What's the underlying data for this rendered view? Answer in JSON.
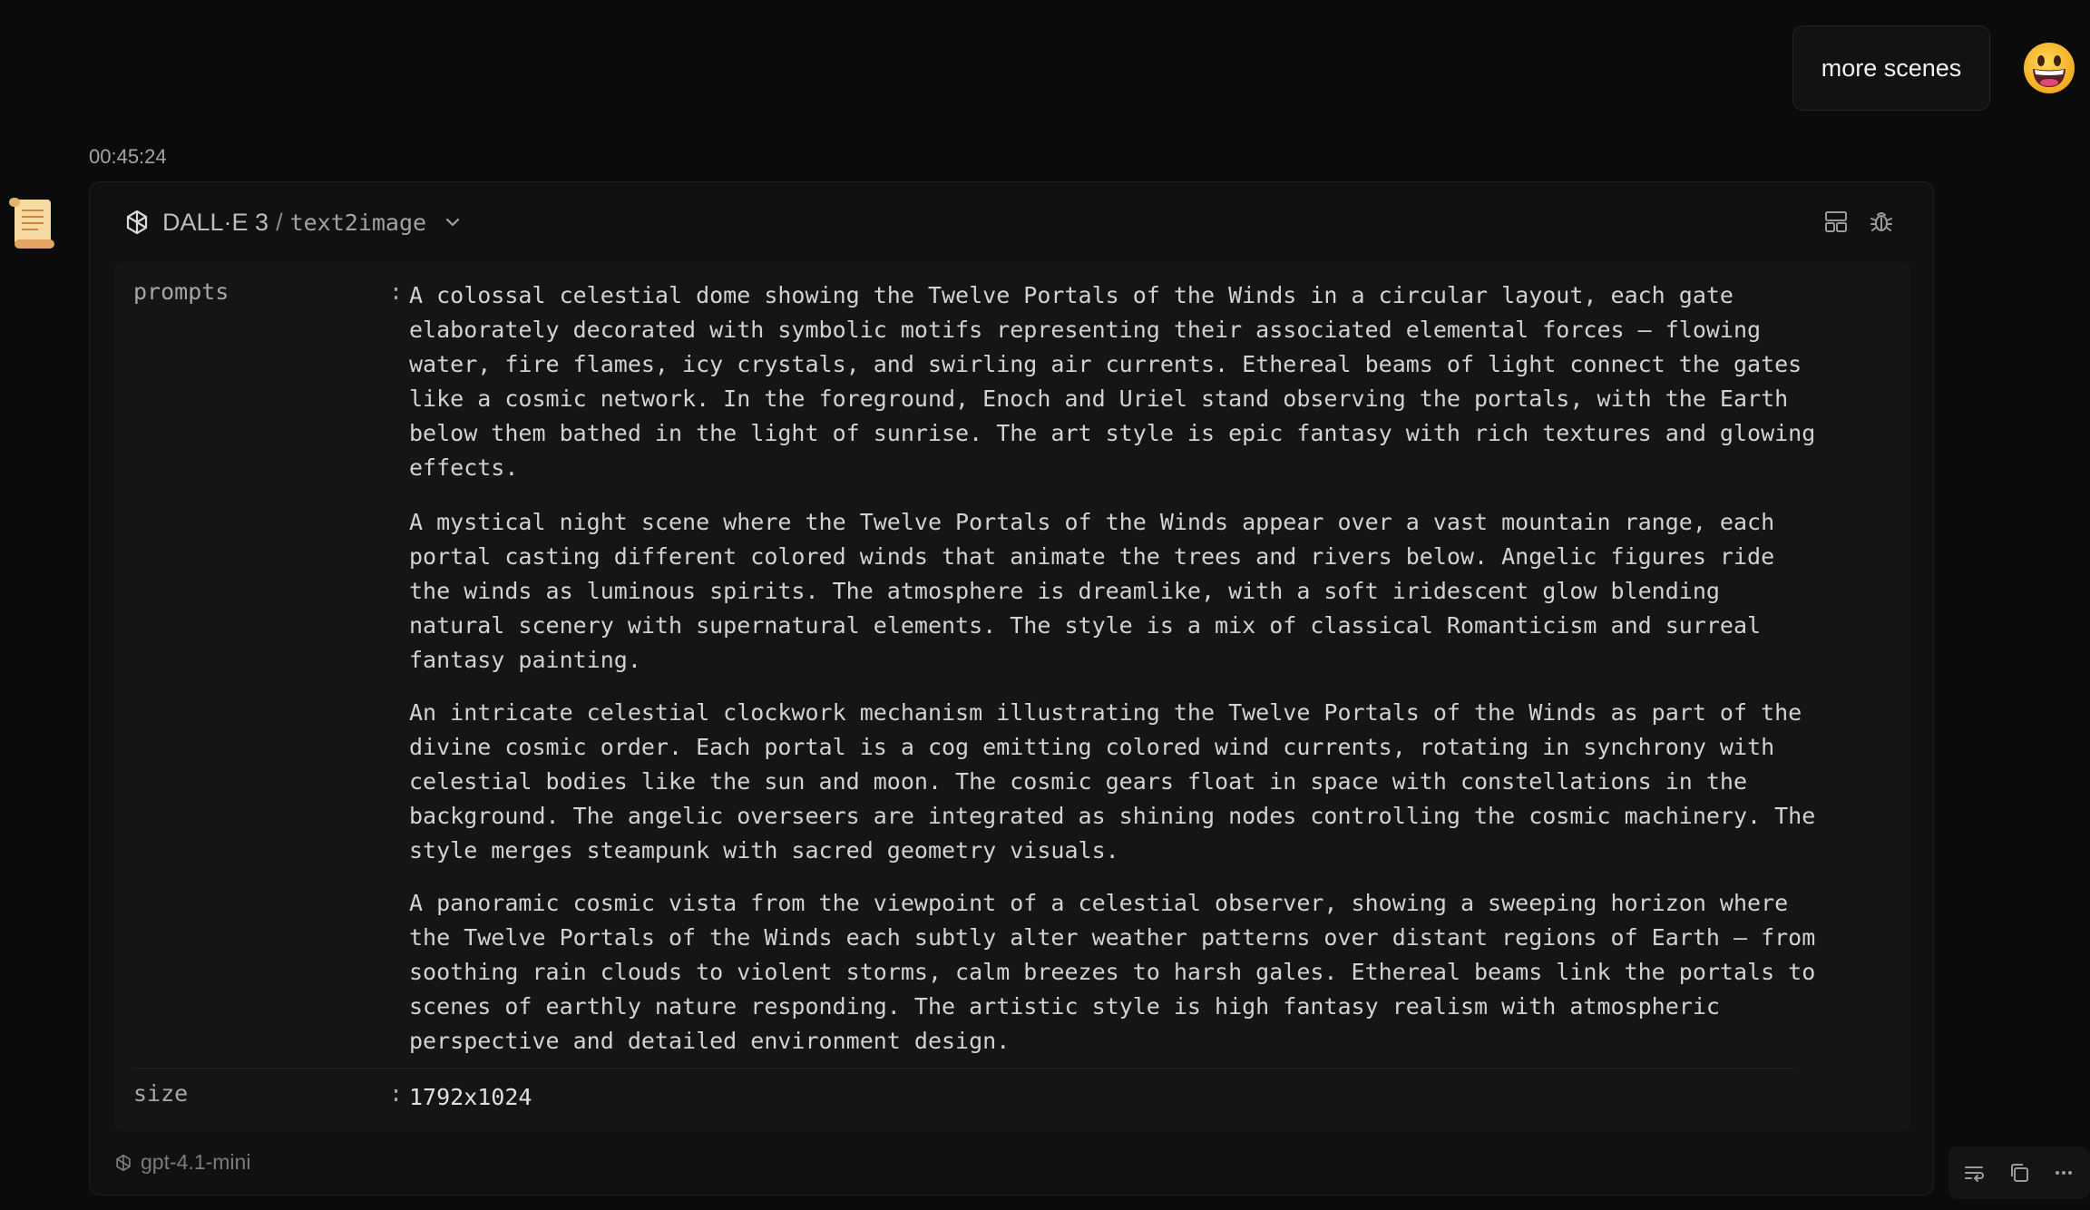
{
  "user_message": {
    "text": "more scenes",
    "avatar_icon": "grinning-face-emoji"
  },
  "assistant": {
    "timestamp": "00:45:24",
    "avatar_icon": "scroll-document-icon",
    "tool_call": {
      "model": "DALL·E 3",
      "separator": "/",
      "tool": "text2image",
      "args": {
        "prompts_key": "prompts",
        "prompts": [
          "A colossal celestial dome showing the Twelve Portals of the Winds in a circular layout, each gate elaborately decorated with symbolic motifs representing their associated elemental forces — flowing water, fire flames, icy crystals, and swirling air currents. Ethereal beams of light connect the gates like a cosmic network. In the foreground, Enoch and Uriel stand observing the portals, with the Earth below them bathed in the light of sunrise. The art style is epic fantasy with rich textures and glowing effects.",
          "A mystical night scene where the Twelve Portals of the Winds appear over a vast mountain range, each portal casting different colored winds that animate the trees and rivers below. Angelic figures ride the winds as luminous spirits. The atmosphere is dreamlike, with a soft iridescent glow blending natural scenery with supernatural elements. The style is a mix of classical Romanticism and surreal fantasy painting.",
          "An intricate celestial clockwork mechanism illustrating the Twelve Portals of the Winds as part of the divine cosmic order. Each portal is a cog emitting colored wind currents, rotating in synchrony with celestial bodies like the sun and moon. The cosmic gears float in space with constellations in the background. The angelic overseers are integrated as shining nodes controlling the cosmic machinery. The style merges steampunk with sacred geometry visuals.",
          "A panoramic cosmic vista from the viewpoint of a celestial observer, showing a sweeping horizon where the Twelve Portals of the Winds each subtly alter weather patterns over distant regions of Earth — from soothing rain clouds to violent storms, calm breezes to harsh gales. Ethereal beams link the portals to scenes of earthly nature responding. The artistic style is high fantasy realism with atmospheric perspective and detailed environment design."
        ],
        "size_key": "size",
        "size": "1792x1024",
        "colon": ":"
      }
    },
    "footer_model": "gpt-4.1-mini"
  },
  "colors": {
    "background": "#0b0b0c",
    "card": "#111112",
    "args_panel": "#151516"
  }
}
